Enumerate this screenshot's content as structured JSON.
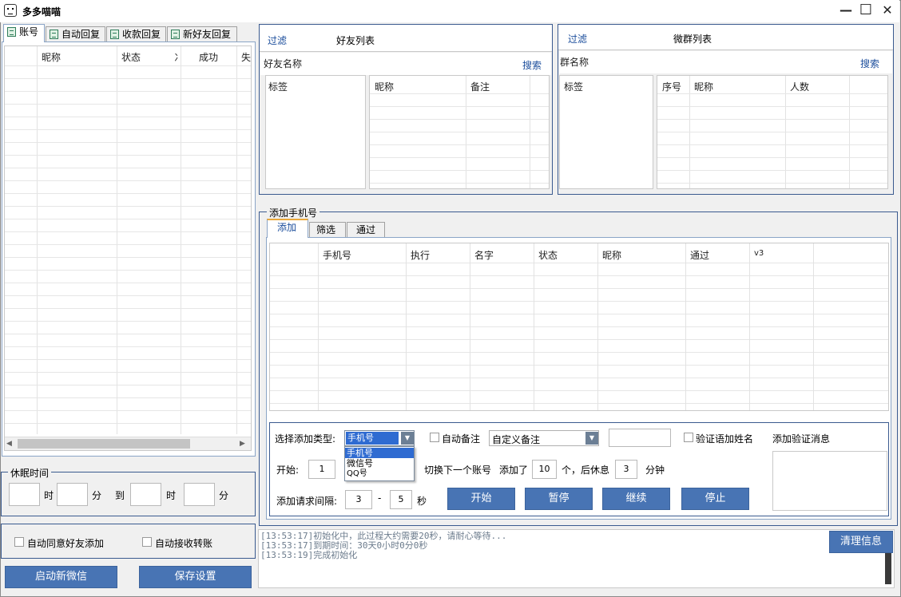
{
  "window": {
    "title": "多多喵喵",
    "minimize": "—",
    "maximize": "☐",
    "close": "✕"
  },
  "left_tabs": [
    "账号",
    "自动回复",
    "收款回复",
    "新好友回复"
  ],
  "account_table": {
    "headers": [
      "昵称",
      "状态",
      "冫",
      "成功",
      "失"
    ]
  },
  "sleep": {
    "title": "休眠时间",
    "hour": "时",
    "minute": "分",
    "to": "到",
    "hour2": "时",
    "minute2": "分"
  },
  "options": {
    "auto_accept": "自动同意好友添加",
    "auto_receive": "自动接收转账"
  },
  "buttons_left": {
    "launch": "启动新微信",
    "save": "保存设置"
  },
  "friend_panel": {
    "filter": "过滤",
    "title": "好友列表",
    "name_label": "好友名称",
    "search": "搜索",
    "tag_header": "标签",
    "headers": [
      "昵称",
      "备注"
    ]
  },
  "group_panel": {
    "filter": "过滤",
    "title": "微群列表",
    "name_label": "群名称",
    "search": "搜索",
    "tag_header": "标签",
    "headers": [
      "序号",
      "昵称",
      "人数"
    ]
  },
  "add_phone": {
    "title": "添加手机号",
    "tabs": [
      "添加",
      "筛选",
      "通过"
    ],
    "headers": [
      "手机号",
      "执行",
      "名字",
      "状态",
      "昵称",
      "通过",
      "v3"
    ],
    "type_label": "选择添加类型:",
    "type_selected": "手机号",
    "type_options": [
      "手机号",
      "微信号",
      "QQ号"
    ],
    "auto_remark": "自动备注",
    "custom_remark": "自定义备注",
    "verify_name": "验证语加姓名",
    "verify_msg_label": "添加验证消息",
    "start_label": "开始:",
    "start_value": "1",
    "switch_label": "切换下一个账号",
    "added_label": "添加了",
    "added_value": "10",
    "rest_label": "个，后休息",
    "rest_value": "3",
    "minute_label": "分钟",
    "interval_label": "添加请求间隔:",
    "interval_from": "3",
    "dash": "-",
    "interval_to": "5",
    "sec_label": "秒",
    "btn_start": "开始",
    "btn_pause": "暂停",
    "btn_continue": "继续",
    "btn_stop": "停止"
  },
  "log": {
    "lines": [
      "[13:53:17]初始化中，此过程大约需要20秒，请耐心等待...",
      "[13:53:17]到期时间：30天0小时0分0秒",
      "[13:53:19]完成初始化"
    ],
    "clear": "清理信息"
  },
  "colors": {
    "accent": "#4874b4",
    "border": "#3a5a8f",
    "link": "#1c4e9c"
  }
}
